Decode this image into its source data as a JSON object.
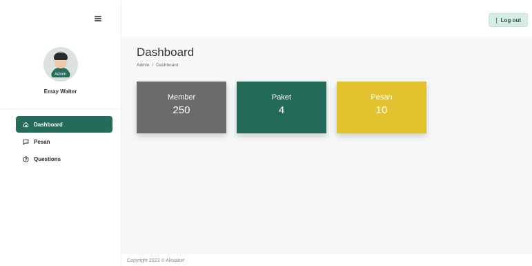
{
  "sidebar": {
    "toggle_icon": "hamburger-icon",
    "profile": {
      "name": "Emay Walter",
      "role": "Admin"
    },
    "items": [
      {
        "label": "Dashboard",
        "icon": "home-icon",
        "active": true
      },
      {
        "label": "Pesan",
        "icon": "message-icon",
        "active": false
      },
      {
        "label": "Questions",
        "icon": "help-circle-icon",
        "active": false
      }
    ]
  },
  "header": {
    "logout_icon": "[",
    "logout_label": "Log out"
  },
  "main": {
    "title": "Dashboard",
    "breadcrumb": [
      "Admin",
      "/",
      "Dashboard"
    ],
    "cards": [
      {
        "label": "Member",
        "value": "250",
        "color": "#6b6b6b"
      },
      {
        "label": "Paket",
        "value": "4",
        "color": "#236a59"
      },
      {
        "label": "Pesan",
        "value": "10",
        "color": "#e2c22f"
      }
    ]
  },
  "footer": {
    "text": "Copyright 2023 © Alexanet"
  },
  "colors": {
    "accent": "#246b5a",
    "logout_bg": "#d6ece6",
    "content_bg": "#f6f7f7"
  }
}
